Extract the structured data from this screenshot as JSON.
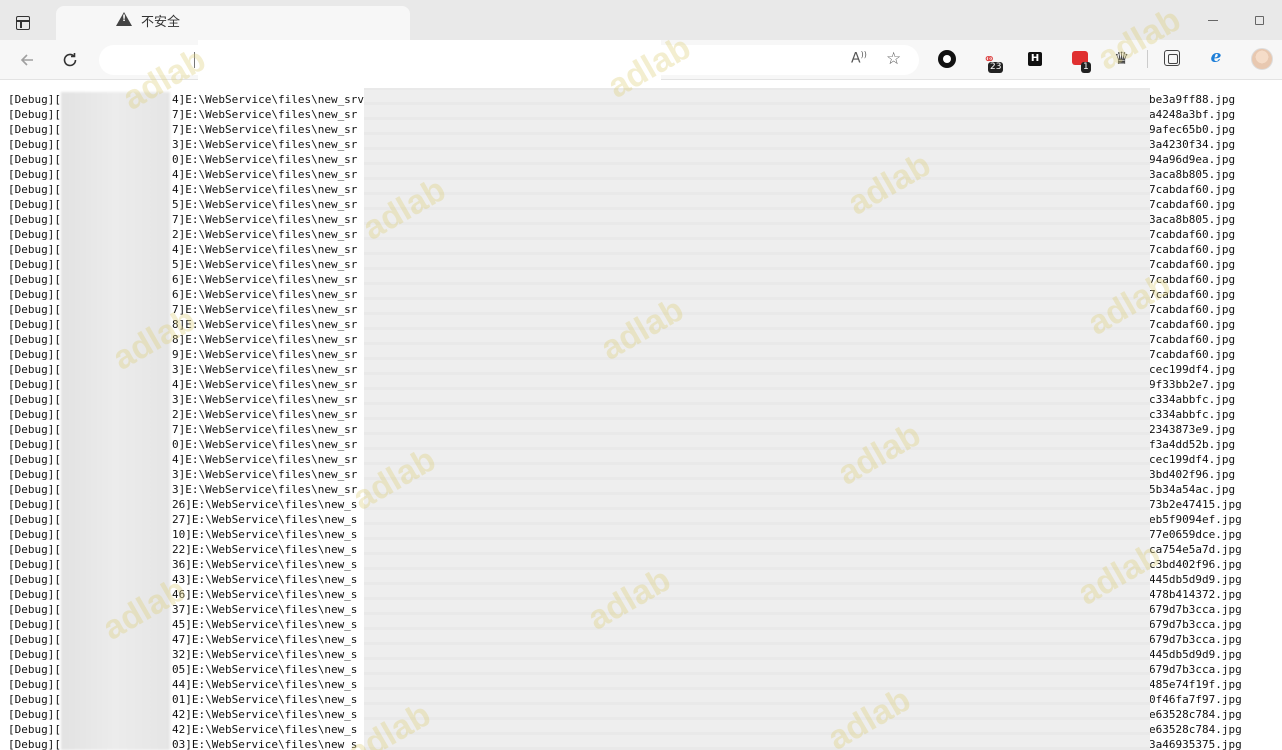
{
  "browser": {
    "security_label": "不安全",
    "read_aloud_label": "Á",
    "extensions": [
      {
        "name": "circle-extension",
        "badge": ""
      },
      {
        "name": "link-extension",
        "badge": "23"
      },
      {
        "name": "h-extension",
        "label": "H",
        "badge": ""
      },
      {
        "name": "red-extension",
        "badge": "1"
      }
    ]
  },
  "watermark_text": "adlab",
  "log_lines": [
    {
      "prefix": "[Debug][",
      "path": "4]E:\\WebService\\files\\new_srv",
      "file": "be3a9ff88.jpg"
    },
    {
      "prefix": "[Debug][",
      "path": "7]E:\\WebService\\files\\new_sr",
      "file": "a4248a3bf.jpg"
    },
    {
      "prefix": "[Debug][",
      "path": "7]E:\\WebService\\files\\new_sr",
      "file": "9afec65b0.jpg"
    },
    {
      "prefix": "[Debug][",
      "path": "3]E:\\WebService\\files\\new_sr",
      "file": "3a4230f34.jpg"
    },
    {
      "prefix": "[Debug][",
      "path": "0]E:\\WebService\\files\\new_sr",
      "file": "94a96d9ea.jpg"
    },
    {
      "prefix": "[Debug][",
      "path": "4]E:\\WebService\\files\\new_sr",
      "file": "3aca8b805.jpg"
    },
    {
      "prefix": "[Debug][",
      "path": "4]E:\\WebService\\files\\new_sr",
      "file": "7cabdaf60.jpg"
    },
    {
      "prefix": "[Debug][",
      "path": "5]E:\\WebService\\files\\new_sr",
      "file": "7cabdaf60.jpg"
    },
    {
      "prefix": "[Debug][",
      "path": "7]E:\\WebService\\files\\new_sr",
      "file": "3aca8b805.jpg"
    },
    {
      "prefix": "[Debug][",
      "path": "2]E:\\WebService\\files\\new_sr",
      "file": "7cabdaf60.jpg"
    },
    {
      "prefix": "[Debug][",
      "path": "4]E:\\WebService\\files\\new_sr",
      "file": "7cabdaf60.jpg"
    },
    {
      "prefix": "[Debug][",
      "path": "5]E:\\WebService\\files\\new_sr",
      "file": "7cabdaf60.jpg"
    },
    {
      "prefix": "[Debug][",
      "path": "6]E:\\WebService\\files\\new_sr",
      "file": "7cabdaf60.jpg"
    },
    {
      "prefix": "[Debug][",
      "path": "6]E:\\WebService\\files\\new_sr",
      "file": "7cabdaf60.jpg"
    },
    {
      "prefix": "[Debug][",
      "path": "7]E:\\WebService\\files\\new_sr",
      "file": "7cabdaf60.jpg"
    },
    {
      "prefix": "[Debug][",
      "path": "8]E:\\WebService\\files\\new_sr",
      "file": "7cabdaf60.jpg"
    },
    {
      "prefix": "[Debug][",
      "path": "8]E:\\WebService\\files\\new_sr",
      "file": "7cabdaf60.jpg"
    },
    {
      "prefix": "[Debug][",
      "path": "9]E:\\WebService\\files\\new_sr",
      "file": "7cabdaf60.jpg"
    },
    {
      "prefix": "[Debug][",
      "path": "3]E:\\WebService\\files\\new_sr",
      "file": "cec199df4.jpg"
    },
    {
      "prefix": "[Debug][",
      "path": "4]E:\\WebService\\files\\new_sr",
      "file": "9f33bb2e7.jpg"
    },
    {
      "prefix": "[Debug][",
      "path": "3]E:\\WebService\\files\\new_sr",
      "file": "c334abbfc.jpg"
    },
    {
      "prefix": "[Debug][",
      "path": "2]E:\\WebService\\files\\new_sr",
      "file": "c334abbfc.jpg"
    },
    {
      "prefix": "[Debug][",
      "path": "7]E:\\WebService\\files\\new_sr",
      "file": "2343873e9.jpg"
    },
    {
      "prefix": "[Debug][",
      "path": "0]E:\\WebService\\files\\new_sr",
      "file": "f3a4dd52b.jpg"
    },
    {
      "prefix": "[Debug][",
      "path": "4]E:\\WebService\\files\\new_sr",
      "file": "cec199df4.jpg"
    },
    {
      "prefix": "[Debug][",
      "path": "3]E:\\WebService\\files\\new_sr",
      "file": "3bd402f96.jpg"
    },
    {
      "prefix": "[Debug][",
      "path": "3]E:\\WebService\\files\\new_sr",
      "file": "5b34a54ac.jpg"
    },
    {
      "prefix": "[Debug][",
      "path": "26]E:\\WebService\\files\\new_s",
      "file": "73b2e47415.jpg"
    },
    {
      "prefix": "[Debug][",
      "path": "27]E:\\WebService\\files\\new_s",
      "file": "eb5f9094ef.jpg"
    },
    {
      "prefix": "[Debug][",
      "path": "10]E:\\WebService\\files\\new_s",
      "file": "77e0659dce.jpg"
    },
    {
      "prefix": "[Debug][",
      "path": "22]E:\\WebService\\files\\new_s",
      "file": "ca754e5a7d.jpg"
    },
    {
      "prefix": "[Debug][",
      "path": "36]E:\\WebService\\files\\new_s",
      "file": "c3bd402f96.jpg"
    },
    {
      "prefix": "[Debug][",
      "path": "43]E:\\WebService\\files\\new_s",
      "file": "445db5d9d9.jpg"
    },
    {
      "prefix": "[Debug][",
      "path": "46]E:\\WebService\\files\\new_s",
      "file": "478b414372.jpg"
    },
    {
      "prefix": "[Debug][",
      "path": "37]E:\\WebService\\files\\new_s",
      "file": "679d7b3cca.jpg"
    },
    {
      "prefix": "[Debug][",
      "path": "45]E:\\WebService\\files\\new_s",
      "file": "679d7b3cca.jpg"
    },
    {
      "prefix": "[Debug][",
      "path": "47]E:\\WebService\\files\\new_s",
      "file": "679d7b3cca.jpg"
    },
    {
      "prefix": "[Debug][",
      "path": "32]E:\\WebService\\files\\new_s",
      "file": "445db5d9d9.jpg"
    },
    {
      "prefix": "[Debug][",
      "path": "05]E:\\WebService\\files\\new_s",
      "file": "679d7b3cca.jpg"
    },
    {
      "prefix": "[Debug][",
      "path": "44]E:\\WebService\\files\\new_s",
      "file": "485e74f19f.jpg"
    },
    {
      "prefix": "[Debug][",
      "path": "01]E:\\WebService\\files\\new_s",
      "file": "0f46fa7f97.jpg"
    },
    {
      "prefix": "[Debug][",
      "path": "42]E:\\WebService\\files\\new_s",
      "file": "e63528c784.jpg"
    },
    {
      "prefix": "[Debug][",
      "path": "42]E:\\WebService\\files\\new_s",
      "file": "e63528c784.jpg"
    },
    {
      "prefix": "[Debug][",
      "path": "03]E:\\WebService\\files\\new_s",
      "file": "3a46935375.jpg"
    }
  ]
}
